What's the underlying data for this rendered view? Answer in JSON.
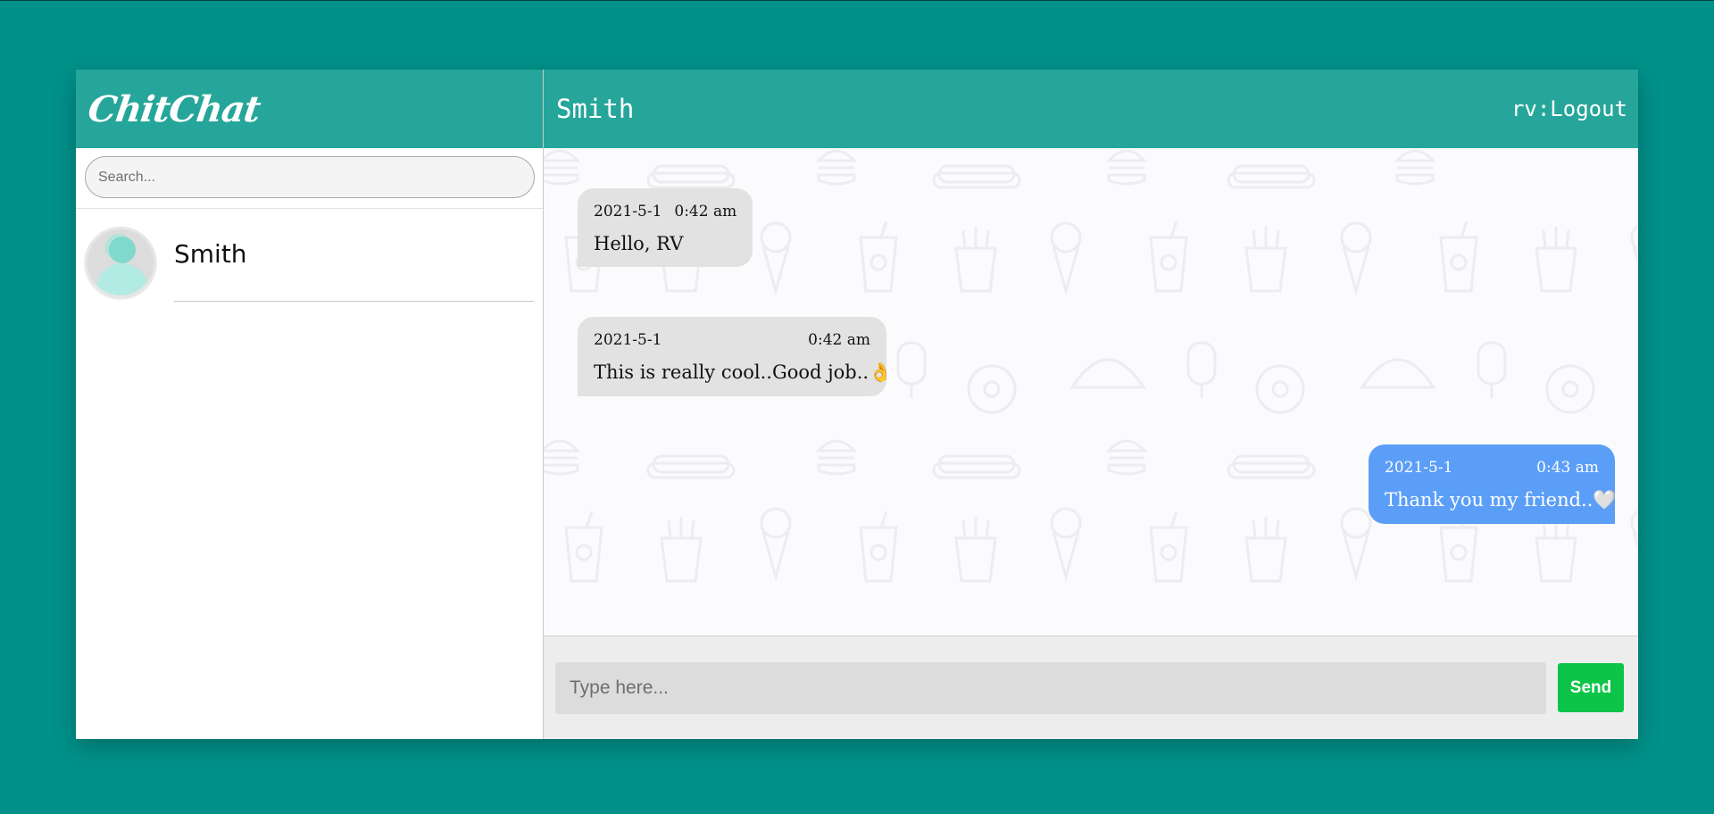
{
  "app": {
    "brand": "ChitChat"
  },
  "search": {
    "placeholder": "Search..."
  },
  "contacts": [
    {
      "name": "Smith"
    }
  ],
  "chat": {
    "title": "Smith",
    "logout_label": "rv:Logout",
    "messages": [
      {
        "direction": "in",
        "date": "2021-5-1",
        "time": "0:42 am",
        "text": "Hello, RV"
      },
      {
        "direction": "in",
        "date": "2021-5-1",
        "time": "0:42 am",
        "text": "This is really cool..Good job..👌"
      },
      {
        "direction": "out",
        "date": "2021-5-1",
        "time": "0:43 am",
        "text": "Thank you my friend..🤍"
      }
    ]
  },
  "composer": {
    "placeholder": "Type here...",
    "send_label": "Send"
  },
  "colors": {
    "background": "#00918a",
    "header": "#26a69a",
    "incoming_bubble": "#e2e2e2",
    "outgoing_bubble": "#5b9ef7",
    "send_button": "#0cc548"
  }
}
